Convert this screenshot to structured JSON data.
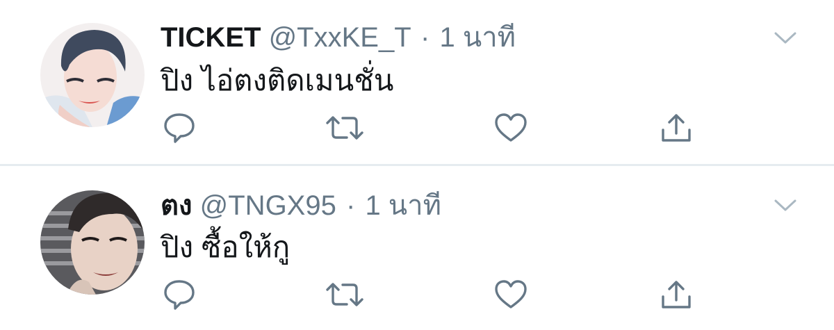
{
  "tweets": [
    {
      "name": "TICKET",
      "handle": "@TxxKE_T",
      "separator": "·",
      "time": "1 นาที",
      "text": "ปิง ไอ่ตงติดเมนชั่น",
      "avatar_icon": "user-avatar",
      "actions": [
        "reply-icon",
        "retweet-icon",
        "like-icon",
        "share-icon"
      ]
    },
    {
      "name": "ตง",
      "handle": "@TNGX95",
      "separator": "·",
      "time": "1 นาที",
      "text": "ปิง ซื้อให้กู",
      "avatar_icon": "user-avatar",
      "actions": [
        "reply-icon",
        "retweet-icon",
        "like-icon",
        "share-icon"
      ]
    }
  ],
  "colors": {
    "name": "#14171a",
    "meta": "#657786",
    "icon": "#657786",
    "divider": "#e6ecf0",
    "chevron": "#aab8c2"
  }
}
